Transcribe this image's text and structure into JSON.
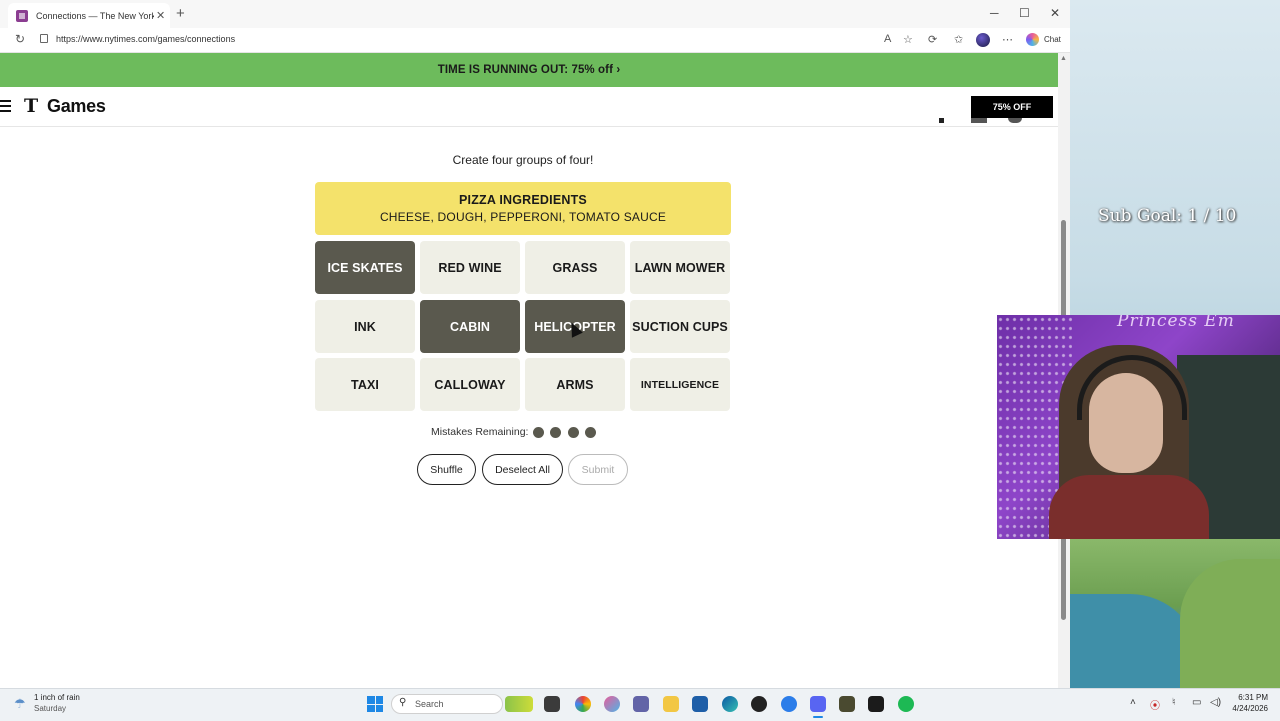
{
  "browser": {
    "tab_title": "Connections — The New York Times",
    "tab_close": "✕",
    "new_tab": "+",
    "url": "https://www.nytimes.com/games/connections",
    "chat_label": "Chat",
    "window_controls": {
      "minimize": "─",
      "maximize": "☐",
      "close": "✕"
    }
  },
  "promo_banner": {
    "text": "TIME IS RUNNING OUT:  75% off ›"
  },
  "header": {
    "logo_mark": "T",
    "logo_text": "Games",
    "offer_button": "75% OFF"
  },
  "game": {
    "instruction": "Create four groups of four!",
    "solved_group": {
      "title": "PIZZA INGREDIENTS",
      "members": "CHEESE, DOUGH, PEPPERONI, TOMATO SAUCE",
      "color": "#f4e26b"
    },
    "tiles": [
      {
        "label": "ICE SKATES",
        "selected": true
      },
      {
        "label": "RED WINE",
        "selected": false
      },
      {
        "label": "GRASS",
        "selected": false
      },
      {
        "label": "LAWN MOWER",
        "selected": false
      },
      {
        "label": "INK",
        "selected": false
      },
      {
        "label": "CABIN",
        "selected": true
      },
      {
        "label": "HELICOPTER",
        "selected": true
      },
      {
        "label": "SUCTION CUPS",
        "selected": false
      },
      {
        "label": "TAXI",
        "selected": false
      },
      {
        "label": "CALLOWAY",
        "selected": false
      },
      {
        "label": "ARMS",
        "selected": false
      },
      {
        "label": "INTELLIGENCE",
        "selected": false
      }
    ],
    "mistakes_label": "Mistakes Remaining:",
    "mistakes_remaining": 4,
    "buttons": {
      "shuffle": "Shuffle",
      "deselect_all": "Deselect All",
      "submit": "Submit"
    },
    "colors": {
      "tile_bg": "#efefe6",
      "tile_selected_bg": "#5a594e"
    }
  },
  "overlay": {
    "sub_goal": "Sub Goal:  1 / 10",
    "webcam_script": "Princess Em"
  },
  "taskbar": {
    "weather_temp": "1 inch of rain",
    "weather_day": "Saturday",
    "search_label": "Search",
    "time": "6:31 PM",
    "date": "4/24/2026"
  }
}
